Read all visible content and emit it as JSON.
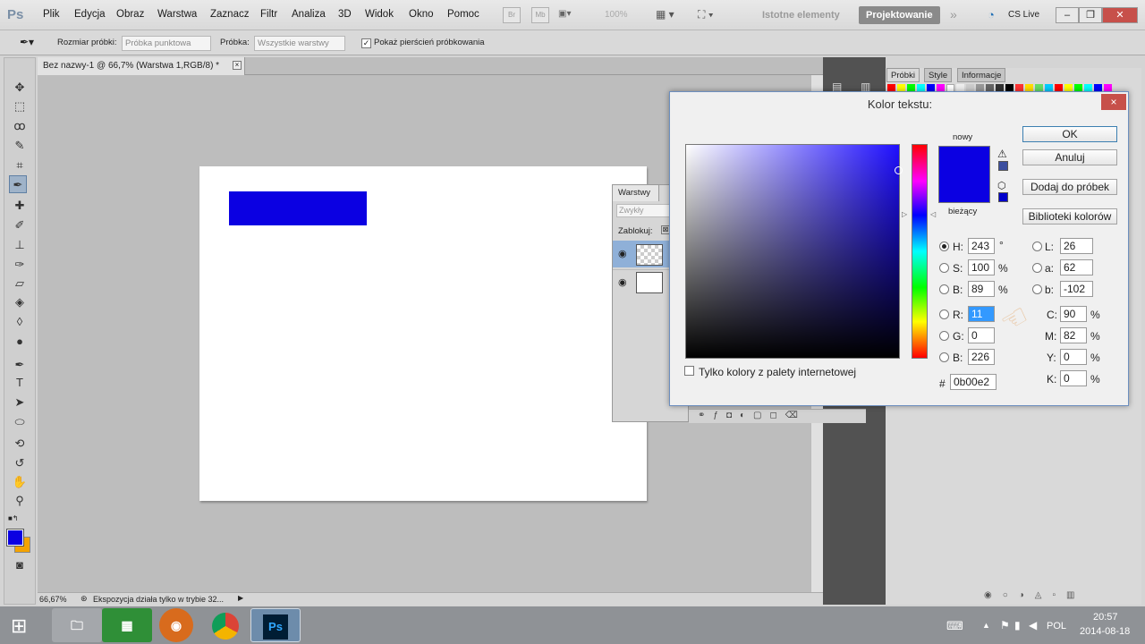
{
  "app": {
    "logo": "Ps"
  },
  "menu": [
    "Plik",
    "Edycja",
    "Obraz",
    "Warstwa",
    "Zaznacz",
    "Filtr",
    "Analiza",
    "3D",
    "Widok",
    "Okno",
    "Pomoc"
  ],
  "menubar_controls": {
    "br": "Br",
    "mb": "Mb",
    "zoom": "100%",
    "essentials": "Istotne elementy",
    "design": "Projektowanie",
    "cs_live": "CS Live"
  },
  "options": {
    "sample_size_label": "Rozmiar próbki:",
    "sample_size_value": "Próbka punktowa",
    "sample_label": "Próbka:",
    "sample_value": "Wszystkie warstwy",
    "show_ring_label": "Pokaż pierścień próbkowania"
  },
  "document": {
    "tab_title": "Bez nazwy-1 @ 66,7% (Warstwa 1,RGB/8) *",
    "status_zoom": "66,67%",
    "status_text": "Ekspozycja działa tylko w trybie 32...",
    "rect_color": "#0b00e2"
  },
  "panels": {
    "tabs": [
      "Próbki",
      "Style",
      "Informacje"
    ]
  },
  "layers": {
    "title": "Warstwy",
    "blend_mode": "Zwykły",
    "lock_label": "Zablokuj:"
  },
  "dialog": {
    "title": "Kolor tekstu:",
    "close": "×",
    "new_label": "nowy",
    "current_label": "bieżący",
    "new_color": "#0b00e2",
    "web_only_label": "Tylko kolory z palety internetowej",
    "buttons": {
      "ok": "OK",
      "cancel": "Anuluj",
      "add_swatch": "Dodaj do próbek",
      "libraries": "Biblioteki kolorów"
    },
    "hsb": {
      "h_label": "H:",
      "h": "243",
      "h_unit": "°",
      "s_label": "S:",
      "s": "100",
      "s_unit": "%",
      "b_label": "B:",
      "b": "89",
      "b_unit": "%"
    },
    "rgb": {
      "r_label": "R:",
      "r": "11",
      "g_label": "G:",
      "g": "0",
      "b_label": "B:",
      "b": "226"
    },
    "lab": {
      "l_label": "L:",
      "l": "26",
      "a_label": "a:",
      "a": "62",
      "b_label": "b:",
      "b": "-102"
    },
    "cmyk": {
      "c_label": "C:",
      "c": "90",
      "m_label": "M:",
      "m": "82",
      "y_label": "Y:",
      "y": "0",
      "k_label": "K:",
      "k": "0",
      "unit": "%"
    },
    "hex_label": "#",
    "hex": "0b00e2"
  },
  "taskbar": {
    "ps_label": "Ps",
    "lang": "POL",
    "time": "20:57",
    "date": "2014-08-18"
  }
}
